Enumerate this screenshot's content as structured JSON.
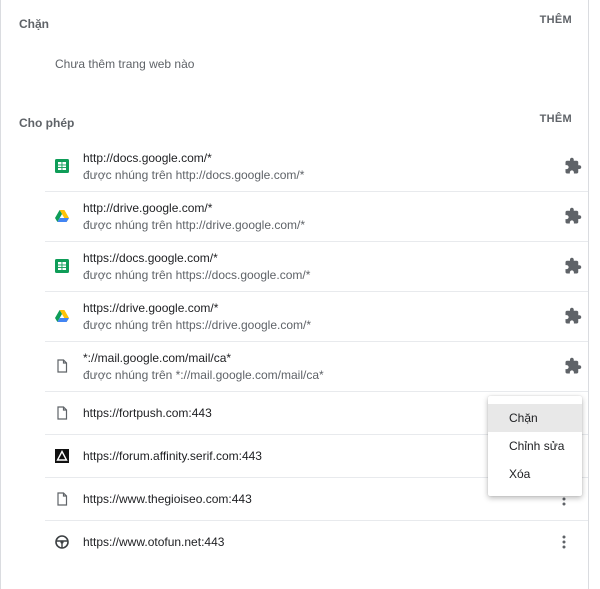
{
  "block": {
    "title": "Chặn",
    "add_label": "THÊM",
    "empty_text": "Chưa thêm trang web nào"
  },
  "allow": {
    "title": "Cho phép",
    "add_label": "THÊM",
    "items": [
      {
        "url": "http://docs.google.com/*",
        "embedded": "được nhúng trên http://docs.google.com/*",
        "icon": "google-sheets-icon"
      },
      {
        "url": "http://drive.google.com/*",
        "embedded": "được nhúng trên http://drive.google.com/*",
        "icon": "google-drive-icon"
      },
      {
        "url": "https://docs.google.com/*",
        "embedded": "được nhúng trên https://docs.google.com/*",
        "icon": "google-sheets-icon"
      },
      {
        "url": "https://drive.google.com/*",
        "embedded": "được nhúng trên https://drive.google.com/*",
        "icon": "google-drive-icon"
      },
      {
        "url": "*://mail.google.com/mail/ca*",
        "embedded": "được nhúng trên *://mail.google.com/mail/ca*",
        "icon": "page-icon"
      },
      {
        "url": "https://fortpush.com:443",
        "icon": "page-icon"
      },
      {
        "url": "https://forum.affinity.serif.com:443",
        "icon": "affinity-icon"
      },
      {
        "url": "https://www.thegioiseo.com:443",
        "icon": "page-icon"
      },
      {
        "url": "https://www.otofun.net:443",
        "icon": "steering-wheel-icon"
      }
    ]
  },
  "context_menu": {
    "items": [
      "Chặn",
      "Chỉnh sửa",
      "Xóa"
    ]
  }
}
